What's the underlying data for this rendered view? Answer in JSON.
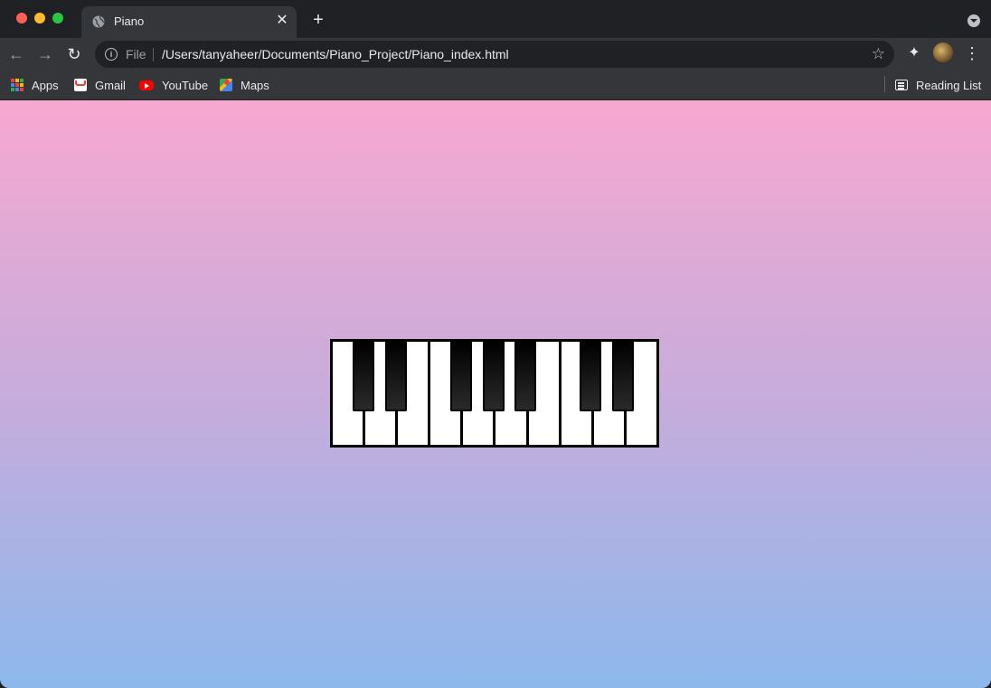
{
  "browser": {
    "tab": {
      "title": "Piano"
    },
    "new_tab_label": "+",
    "omnibox": {
      "scheme_label": "File",
      "url": "/Users/tanyaheer/Documents/Piano_Project/Piano_index.html"
    },
    "bookmarks": [
      {
        "label": "Apps",
        "icon": "apps-grid-icon"
      },
      {
        "label": "Gmail",
        "icon": "gmail-icon"
      },
      {
        "label": "YouTube",
        "icon": "youtube-icon"
      },
      {
        "label": "Maps",
        "icon": "maps-icon"
      }
    ],
    "reading_list": {
      "label": "Reading List",
      "icon": "reading-list-icon"
    }
  },
  "page": {
    "background_colors": [
      "#f7a8d0",
      "#c7acdc",
      "#8db8ec"
    ],
    "piano": {
      "white_key_count": 10,
      "black_key_count": 7,
      "white_key_color": "#ffffff",
      "black_key_color": "#000000"
    }
  }
}
